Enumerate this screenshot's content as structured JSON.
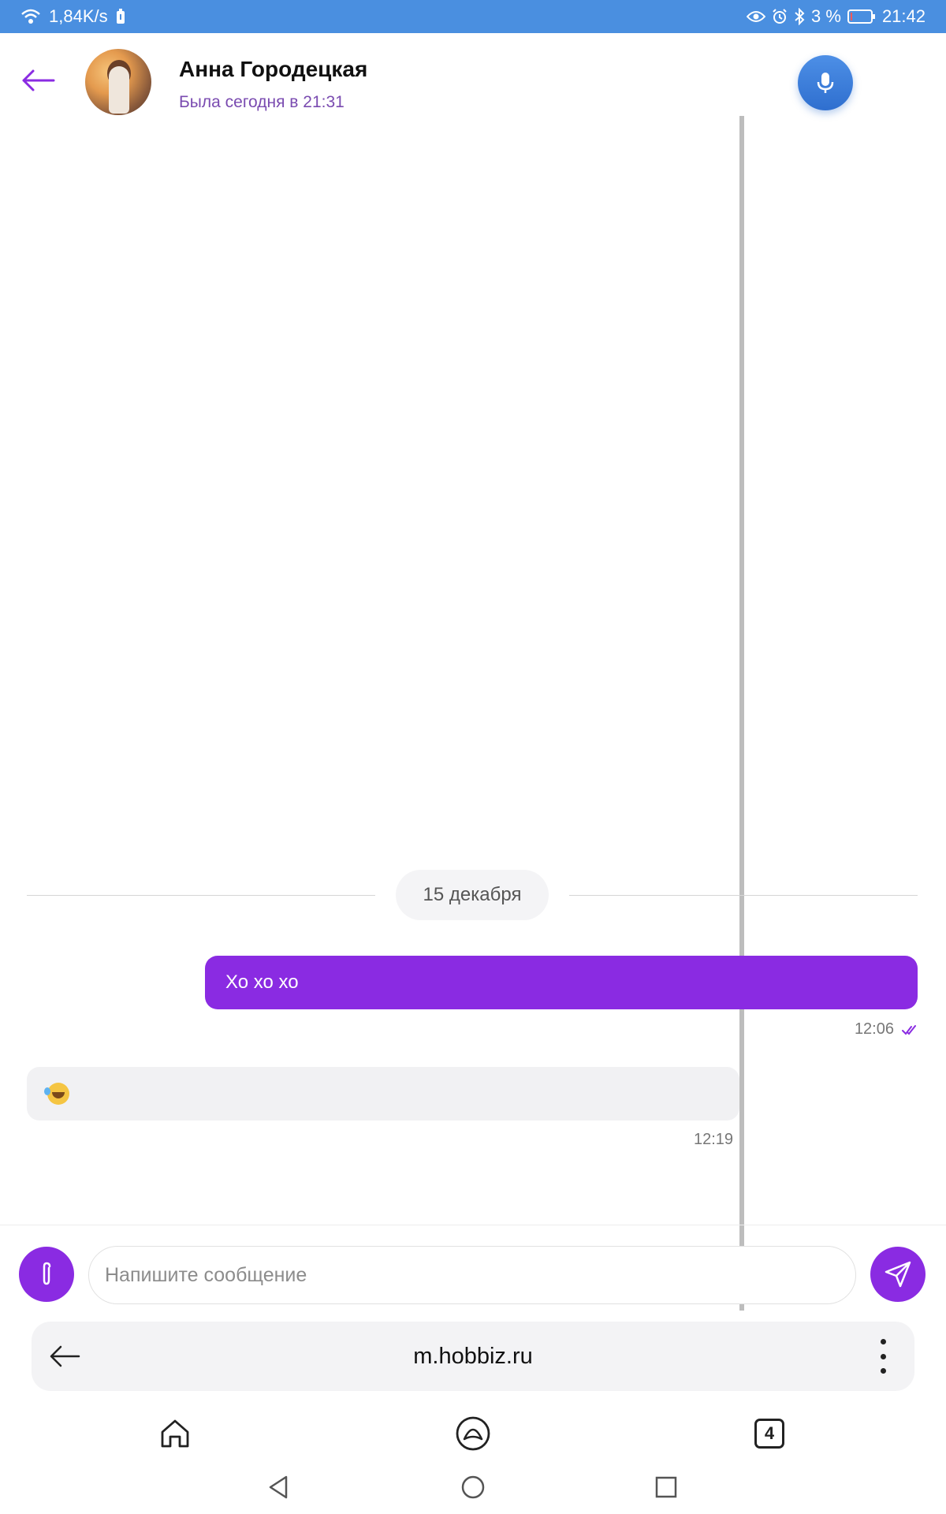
{
  "status_bar": {
    "speed": "1,84K/s",
    "battery_pct": "3 %",
    "time": "21:42",
    "icons": [
      "wifi-icon",
      "battery-saver-icon",
      "eye-icon",
      "alarm-icon",
      "bluetooth-icon",
      "battery-icon"
    ]
  },
  "header": {
    "back_icon": "arrow-left-icon",
    "contact_name": "Анна Городецкая",
    "contact_status": "Была сегодня в 21:31",
    "mic_icon": "microphone-icon"
  },
  "chat": {
    "date_separator": "15 декабря",
    "messages": [
      {
        "direction": "outgoing",
        "text": "Хо хо хо",
        "time": "12:06",
        "read_icon": "double-check-icon"
      },
      {
        "direction": "incoming",
        "emoji_icon": "rofl-emoji-icon",
        "time": "12:19"
      }
    ]
  },
  "composer": {
    "attach_icon": "paperclip-icon",
    "placeholder": "Напишите сообщение",
    "send_icon": "send-icon"
  },
  "browser": {
    "url": "m.hobbiz.ru",
    "tabs_count": "4",
    "icons": [
      "arrow-left-icon",
      "kebab-menu-icon",
      "home-icon",
      "alice-icon",
      "tabs-icon"
    ]
  },
  "system_nav": {
    "icons": [
      "nav-back-icon",
      "nav-home-icon",
      "nav-recents-icon"
    ]
  },
  "colors": {
    "status_bar": "#4a8fe0",
    "accent": "#8a2be2",
    "mic_button": "#2f6fcf",
    "status_text": "#7a4bb0"
  }
}
